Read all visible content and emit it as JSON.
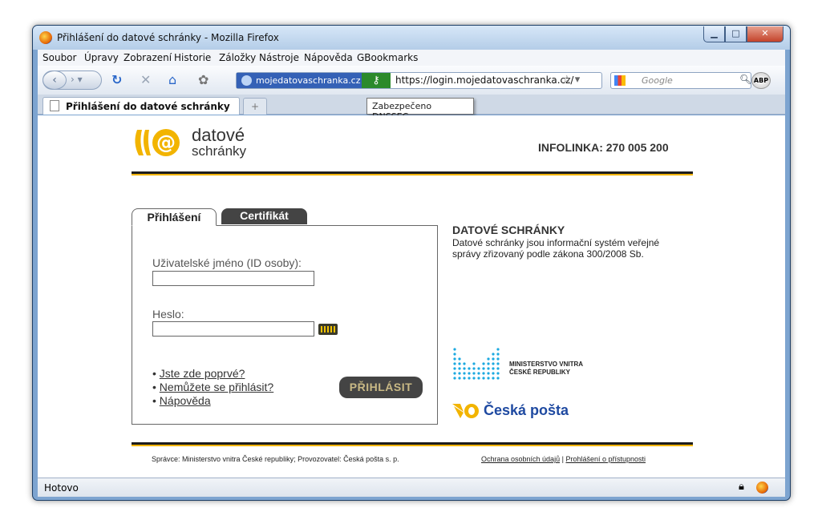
{
  "window": {
    "title": "Přihlášení do datové schránky - Mozilla Firefox"
  },
  "menu": [
    "Soubor",
    "Úpravy",
    "Zobrazení",
    "Historie",
    "Záložky",
    "Nástroje",
    "Nápověda",
    "GBookmarks"
  ],
  "navbar": {
    "identity_label": "mojedatovaschranka.cz",
    "url": "https://login.mojedatovaschranka.cz/",
    "search_placeholder": "Google",
    "abp_label": "ABP"
  },
  "tab": {
    "label": "Přihlášení do datové schránky"
  },
  "tooltip": "Zabezpečeno DNSSEC",
  "page": {
    "logo_line1": "datové",
    "logo_line2": "schránky",
    "infolinka": "INFOLINKA: 270 005 200",
    "tabs": {
      "login": "Přihlášení",
      "certificate": "Certifikát"
    },
    "username_label": "Uživatelské jméno (ID osoby):",
    "password_label": "Heslo:",
    "links": [
      "Jste zde poprvé?",
      "Nemůžete se přihlásit?",
      "Nápověda"
    ],
    "login_button": "PŘIHLÁSIT",
    "info_title": "DATOVÉ SCHRÁNKY",
    "info_text": "Datové schránky jsou informační systém veřejné správy zřizovaný podle zákona 300/2008 Sb.",
    "mv_line1": "MINISTERSTVO VNITRA",
    "mv_line2": "ČESKÉ REPUBLIKY",
    "cp_text": "Česká pošta",
    "footer_left": "Správce: Ministerstvo vnitra České republiky; Provozovatel: Česká pošta s. p.",
    "footer_privacy": "Ochrana osobních údajů",
    "footer_sep": "|",
    "footer_access": "Prohlášení o přístupnosti"
  },
  "status": {
    "text": "Hotovo"
  },
  "colors": {
    "accent_yellow": "#f2b400",
    "dark": "#1d1d1d",
    "cp_blue": "#1f4aa1",
    "mv_cyan": "#1ba9e0"
  }
}
